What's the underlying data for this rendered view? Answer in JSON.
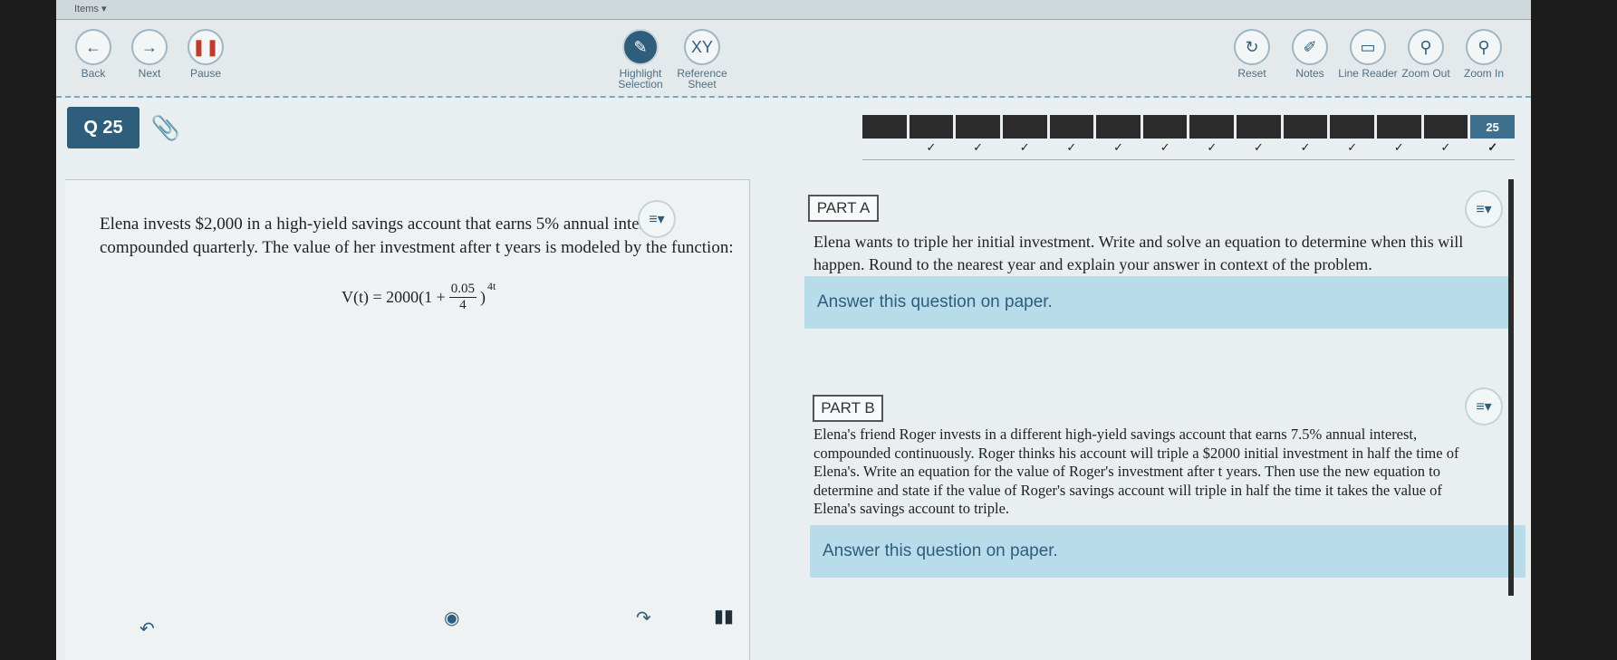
{
  "top_strip": {
    "label": "Items ▾"
  },
  "toolbar": {
    "back": {
      "label": "Back",
      "icon": "arrow-left-icon"
    },
    "next": {
      "label": "Next",
      "icon": "arrow-right-icon"
    },
    "pause": {
      "label": "Pause",
      "icon": "pause-icon"
    },
    "highlight": {
      "label": "Highlight Selection",
      "icon": "highlighter-icon"
    },
    "reference": {
      "label": "Reference Sheet",
      "glyph": "XY"
    },
    "reset": {
      "label": "Reset",
      "icon": "refresh-icon"
    },
    "notes": {
      "label": "Notes",
      "icon": "notes-icon"
    },
    "line_reader": {
      "label": "Line Reader",
      "icon": "line-reader-icon"
    },
    "zoom_out": {
      "label": "Zoom Out",
      "icon": "zoom-out-icon"
    },
    "zoom_in": {
      "label": "Zoom In",
      "icon": "zoom-in-icon"
    }
  },
  "question": {
    "badge": "Q 25",
    "current_number": "25"
  },
  "passage": {
    "text": "Elena invests $2,000 in a high-yield savings account that earns 5% annual interest, compounded quarterly. The value of her investment after t years is modeled by the function:",
    "formula_lhs": "V(t) = 2000(1 +",
    "formula_num": "0.05",
    "formula_den": "4",
    "formula_close": ")",
    "formula_exp": "4t"
  },
  "part_a": {
    "label": "PART A",
    "text": "Elena wants to triple her initial investment. Write and solve an equation to determine when this will happen. Round to the nearest year and explain your answer in context of the problem.",
    "answer": "Answer this question on paper."
  },
  "part_b": {
    "label": "PART B",
    "text": "Elena's friend Roger invests in a different high-yield savings account that earns 7.5% annual interest, compounded continuously. Roger thinks his account will triple a $2000 initial investment in half the time of Elena's. Write an equation for the value of Roger's investment after t years. Then use the new equation to determine and state if the value of Roger's savings account will triple in half the time it takes the value of Elena's savings account to triple.",
    "answer": "Answer this question on paper."
  },
  "menu_icon": "≡▾",
  "colors": {
    "accent": "#2f5d7c",
    "answer_bg": "#b9dcea"
  }
}
